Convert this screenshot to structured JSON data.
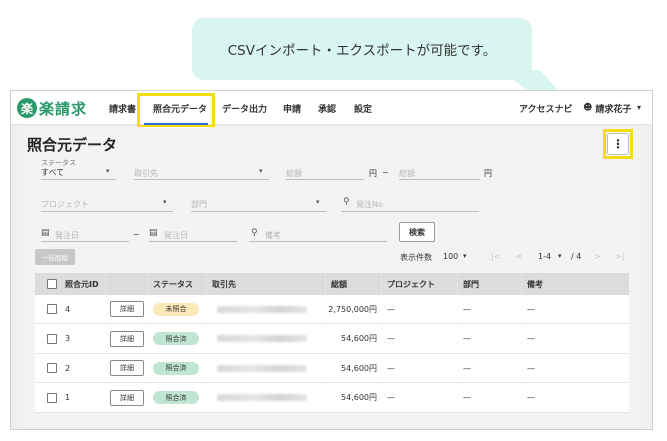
{
  "callout": {
    "text": "CSVインポート・エクスポートが可能です。"
  },
  "header": {
    "logo_mark": "楽",
    "logo_text": "楽請求",
    "nav": [
      "請求書",
      "照合元データ",
      "データ出力",
      "申請",
      "承認",
      "設定"
    ],
    "active_nav": "照合元データ",
    "guide": "アクセスナビ",
    "user": "請求花子"
  },
  "page": {
    "title": "照合元データ",
    "kebab": "⋮"
  },
  "filters": {
    "status_label": "ステータス",
    "status_value": "すべて",
    "partner_placeholder": "取引先",
    "amount_from_placeholder": "総額",
    "yen": "円",
    "tilde": "~",
    "amount_to_placeholder": "総額",
    "project_placeholder": "プロジェクト",
    "dept_placeholder": "部門",
    "order_no_placeholder": "発注No.",
    "date_from_placeholder": "発注日",
    "date_to_placeholder": "発注日",
    "remarks_placeholder": "備考",
    "search_button": "検索",
    "bulk_delete_button": "一括削除"
  },
  "pagination": {
    "rows_label": "表示件数",
    "rows_value": "100",
    "range": "1-4",
    "total": "/ 4"
  },
  "table": {
    "headers": [
      "照合元ID",
      "",
      "ステータス",
      "取引先",
      "総額",
      "プロジェクト",
      "部門",
      "備考"
    ],
    "detail_label": "詳細",
    "rows": [
      {
        "id": "4",
        "status": "未照合",
        "status_color": "#fde9b8",
        "amount": "2,750,000円",
        "project": "—",
        "dept": "—",
        "remarks": "—"
      },
      {
        "id": "3",
        "status": "照合済",
        "status_color": "#bfe6d3",
        "amount": "54,600円",
        "project": "—",
        "dept": "—",
        "remarks": "—"
      },
      {
        "id": "2",
        "status": "照合済",
        "status_color": "#bfe6d3",
        "amount": "54,600円",
        "project": "—",
        "dept": "—",
        "remarks": "—"
      },
      {
        "id": "1",
        "status": "照合済",
        "status_color": "#bfe6d3",
        "amount": "54,600円",
        "project": "—",
        "dept": "—",
        "remarks": "—"
      }
    ]
  },
  "colors": {
    "brand": "#2a9a6a",
    "active_tab": "#2a6fcf",
    "highlight": "#f2dc14",
    "callout": "#d9f5ef"
  }
}
